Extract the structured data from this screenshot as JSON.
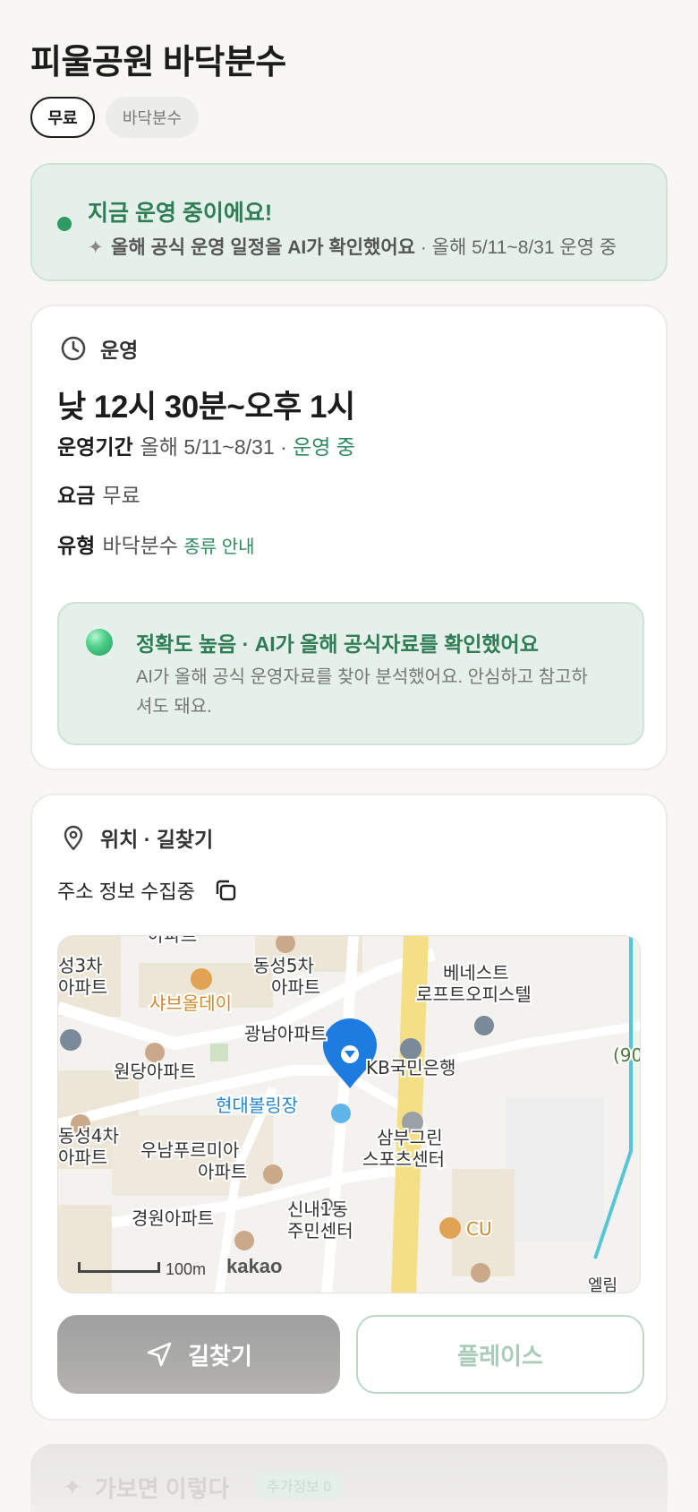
{
  "header": {
    "title": "피울공원 바닥분수",
    "chips": [
      "무료",
      "바닥분수"
    ]
  },
  "status": {
    "title": "지금 운영 중이에요!",
    "note_strong": "올해 공식 운영 일정을 AI가 확인했어요",
    "note_detail": " · 올해 5/11~8/31 운영 중"
  },
  "operation": {
    "section_label": "운영",
    "hours": "낮 12시 30분~오후 1시",
    "period_label": "운영기간",
    "period_value": "올해 5/11~8/31 ·",
    "period_status": "운영 중",
    "fee_label": "요금",
    "fee_value": "무료",
    "type_label": "유형",
    "type_value": "바닥분수",
    "type_link": "종류 안내",
    "accuracy_title": "정확도 높음 · AI가 올해 공식자료를 확인했어요",
    "accuracy_desc": "AI가 올해 공식 운영자료를 찾아 분석했어요. 안심하고 참고하셔도 돼요."
  },
  "location": {
    "section_label": "위치 · 길찾기",
    "address": "주소 정보 수집중",
    "map": {
      "labels": [
        "아파트",
        "동성5차\n아파트",
        "성3차\n아파트",
        "샤브올데이",
        "베네스트\n로프트오피스텔",
        "광남아파트",
        "KB국민은행",
        "원당아파트",
        "현대볼링장",
        "동성4차\n아파트",
        "우남푸르미아\n아파트",
        "삼부그린\n스포츠센터",
        "신내1동\n주민센터",
        "경원아파트",
        "CU",
        "엘림",
        "(90"
      ],
      "scale": "100m",
      "provider": "kakao"
    },
    "buttons": {
      "directions": "길찾기",
      "place": "플레이스"
    }
  },
  "next_section": {
    "title": "가보면 이렇다",
    "badge": "추가정보 0"
  },
  "colors": {
    "accent_green": "#2e7d55",
    "status_bg": "#e6f0ea",
    "pin_blue": "#1e7be0"
  }
}
